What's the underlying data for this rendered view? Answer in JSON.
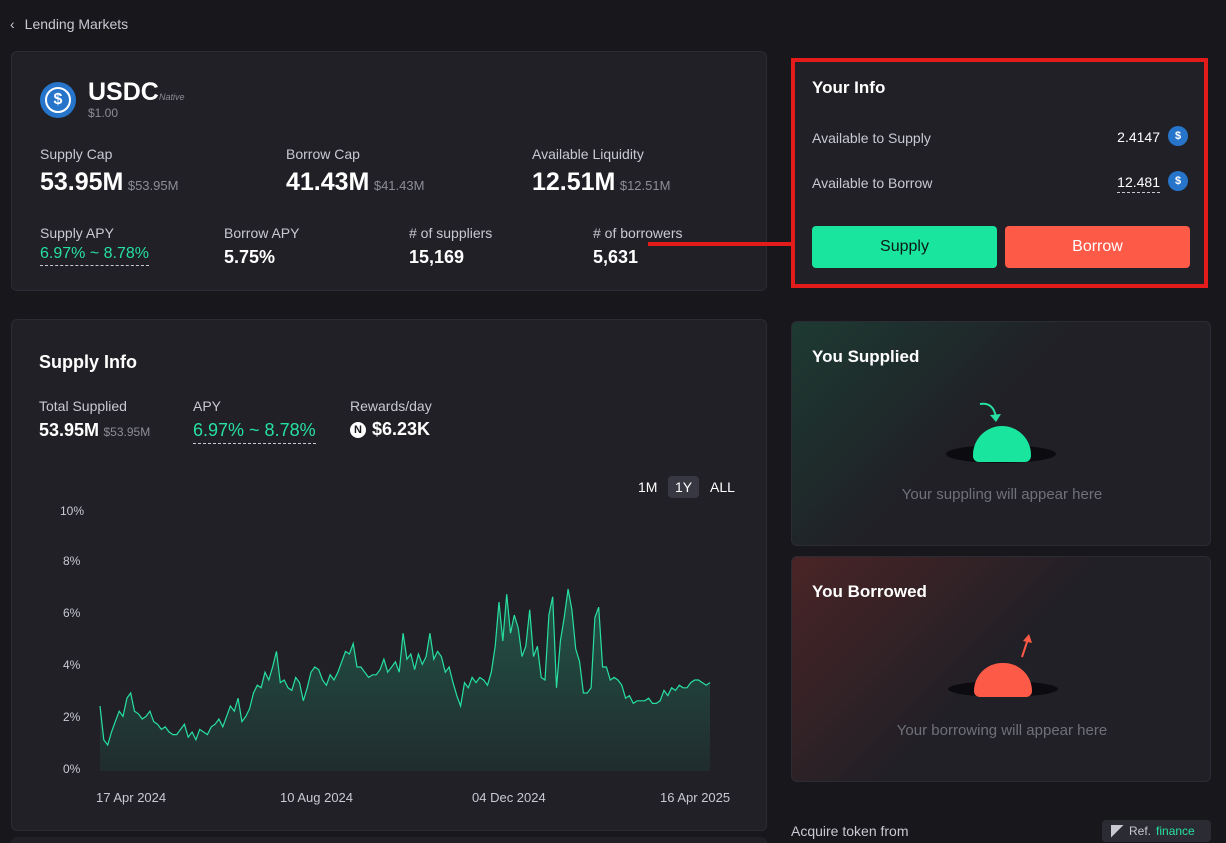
{
  "breadcrumb": {
    "back_label": "Lending Markets"
  },
  "token": {
    "symbol": "USDC",
    "tag": "Native",
    "price": "$1.00",
    "icon": "usdc-coin-icon",
    "stats": {
      "supply_cap_label": "Supply Cap",
      "supply_cap_value": "53.95M",
      "supply_cap_usd": "$53.95M",
      "borrow_cap_label": "Borrow Cap",
      "borrow_cap_value": "41.43M",
      "borrow_cap_usd": "$41.43M",
      "liquidity_label": "Available Liquidity",
      "liquidity_value": "12.51M",
      "liquidity_usd": "$12.51M",
      "supply_apy_label": "Supply APY",
      "supply_apy_value": "6.97% ~ 8.78%",
      "borrow_apy_label": "Borrow APY",
      "borrow_apy_value": "5.75%",
      "suppliers_label": "# of suppliers",
      "suppliers_value": "15,169",
      "borrowers_label": "# of borrowers",
      "borrowers_value": "5,631"
    }
  },
  "your_info": {
    "title": "Your Info",
    "available_supply_label": "Available to Supply",
    "available_supply_value": "2.4147",
    "available_borrow_label": "Available to Borrow",
    "available_borrow_value": "12.481",
    "supply_button": "Supply",
    "borrow_button": "Borrow"
  },
  "supply_info": {
    "title": "Supply Info",
    "total_supplied_label": "Total Supplied",
    "total_supplied_value": "53.95M",
    "total_supplied_usd": "$53.95M",
    "apy_label": "APY",
    "apy_value": "6.97% ~ 8.78%",
    "rewards_label": "Rewards/day",
    "rewards_value": "$6.23K",
    "ranges": [
      "1M",
      "1Y",
      "ALL"
    ],
    "selected_range": "1Y"
  },
  "you_supplied": {
    "title": "You Supplied",
    "empty_text": "Your suppling will appear here"
  },
  "you_borrowed": {
    "title": "You Borrowed",
    "empty_text": "Your borrowing will appear here"
  },
  "acquire": {
    "label": "Acquire token from",
    "partner": "Ref.",
    "partner_suffix": "finance"
  },
  "colors": {
    "accent_green": "#27e0a0",
    "accent_red": "#fd5a47",
    "highlight_red": "#e31b1b",
    "background": "#17171c",
    "card": "#202026"
  },
  "chart_data": {
    "type": "area",
    "yticks": [
      "10%",
      "8%",
      "6%",
      "4%",
      "2%",
      "0%"
    ],
    "ylim": [
      0,
      10
    ],
    "xticks": [
      "17 Apr 2024",
      "10 Aug 2024",
      "04 Dec 2024",
      "16 Apr 2025"
    ],
    "series": [
      {
        "values": [
          2.5,
          1.2,
          1.0,
          1.5,
          1.9,
          2.3,
          2.1,
          2.8,
          3.0,
          2.3,
          2.2,
          2.0,
          2.1,
          2.3,
          1.9,
          1.8,
          1.6,
          1.7,
          1.5,
          1.4,
          1.4,
          1.6,
          1.8,
          1.3,
          1.5,
          1.2,
          1.6,
          1.5,
          1.4,
          1.7,
          1.8,
          2.0,
          1.7,
          2.1,
          2.5,
          2.3,
          2.8,
          1.9,
          2.1,
          2.4,
          3.0,
          3.3,
          3.2,
          3.8,
          3.5,
          4.0,
          4.6,
          3.4,
          3.5,
          3.2,
          3.1,
          3.6,
          3.4,
          2.7,
          3.2,
          3.8,
          4.0,
          3.9,
          3.5,
          3.3,
          3.7,
          3.5,
          3.8,
          4.2,
          4.6,
          4.5,
          4.9,
          4.0,
          4.0,
          3.8,
          3.6,
          3.7,
          3.7,
          3.9,
          4.3,
          3.8,
          4.0,
          4.2,
          3.8,
          5.3,
          4.3,
          4.5,
          3.9,
          4.5,
          4.1,
          4.4,
          5.3,
          4.3,
          4.6,
          4.4,
          3.8,
          4.0,
          3.4,
          2.9,
          2.5,
          3.4,
          3.2,
          3.6,
          3.4,
          3.6,
          3.5,
          3.3,
          3.8,
          4.8,
          6.5,
          5.0,
          6.8,
          5.3,
          6.0,
          5.5,
          4.4,
          4.8,
          6.2,
          4.4,
          4.8,
          3.6,
          3.5,
          6.0,
          6.7,
          3.2,
          5.0,
          5.9,
          7.0,
          6.2,
          4.7,
          4.2,
          3.0,
          3.0,
          3.2,
          5.9,
          6.3,
          4.0,
          4.0,
          3.5,
          3.6,
          3.5,
          3.3,
          2.8,
          2.9,
          2.6,
          2.7,
          2.7,
          2.7,
          2.8,
          2.6,
          2.6,
          2.7,
          3.1,
          2.9,
          3.2,
          3.1,
          3.3,
          3.2,
          3.2,
          3.4,
          3.5,
          3.5,
          3.4,
          3.3,
          3.4
        ]
      }
    ]
  }
}
